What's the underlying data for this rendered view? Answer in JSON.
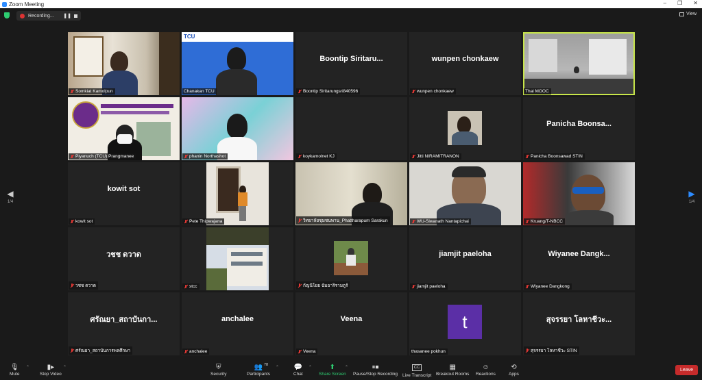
{
  "window": {
    "title": "Zoom Meeting",
    "minimize": "–",
    "maximize": "❐",
    "close": "✕"
  },
  "topbar": {
    "recording_label": "Recording...",
    "pause_glyph": "❚❚",
    "view_label": "View"
  },
  "nav": {
    "page_left": "1/4",
    "page_right": "1/4",
    "left_arrow": "◀",
    "right_arrow": "▶"
  },
  "tiles": [
    {
      "name_label": "Somkiat Kamolpun",
      "center_text": "",
      "active": false
    },
    {
      "name_label": "Chanakan TCU",
      "center_text": "",
      "active": false
    },
    {
      "name_label": "Boontip Siritarungsri840596",
      "center_text": "Boontip  Siritaru...",
      "active": false
    },
    {
      "name_label": "wunpen chonkaew",
      "center_text": "wunpen chonkaew",
      "active": false
    },
    {
      "name_label": "Thai MOOC",
      "center_text": "",
      "active": true
    },
    {
      "name_label": "Piyanuch (TCU) Prangmanee",
      "center_text": "",
      "active": false
    },
    {
      "name_label": "phanin Northashot",
      "center_text": "",
      "active": false
    },
    {
      "name_label": "koykamolnet KJ",
      "center_text": "",
      "active": false
    },
    {
      "name_label": "Jitti NIRAMITRANON",
      "center_text": "",
      "active": false
    },
    {
      "name_label": "Panicha Boonsawad STIN",
      "center_text": "Panicha  Boonsa...",
      "active": false
    },
    {
      "name_label": "kowit sot",
      "center_text": "kowit sot",
      "active": false
    },
    {
      "name_label": "Pete Thipwajana",
      "center_text": "",
      "active": false
    },
    {
      "name_label": "วิทยาลัยชุมชนพาน_Phattharapum Sarakun",
      "center_text": "",
      "active": false
    },
    {
      "name_label": "WU-Siwanath Nantapichai",
      "center_text": "",
      "active": false
    },
    {
      "name_label": "Kruang/T-NBCC",
      "center_text": "",
      "active": false
    },
    {
      "name_label": "วชช ดวาด",
      "center_text": "วชช ดวาด",
      "active": false
    },
    {
      "name_label": "stcc",
      "center_text": "",
      "active": false
    },
    {
      "name_label": "กัญนิโยย ฉัมอาริรามฤูร์",
      "center_text": "",
      "active": false
    },
    {
      "name_label": "jiamjit paeloha",
      "center_text": "jiamjit paeloha",
      "active": false
    },
    {
      "name_label": "Wiyanee Dangkong",
      "center_text": "Wiyanee  Dangk...",
      "active": false
    },
    {
      "name_label": "ศรัณยา_สถาบันการพลศึกษา",
      "center_text": "ศรัณยา_สถาบันกา...",
      "active": false
    },
    {
      "name_label": "anchalee",
      "center_text": "anchalee",
      "active": false
    },
    {
      "name_label": "Veena",
      "center_text": "Veena",
      "active": false
    },
    {
      "name_label": "thasanee pokhun",
      "center_text": "",
      "active": false,
      "avatar_letter": "t",
      "avatar_color": "#5b2fa6"
    },
    {
      "name_label": "สุจรรยา  โลหาชีวะ STIN",
      "center_text": "สุจรรยา  โลหาชีวะ...",
      "active": false
    }
  ],
  "toolbar": {
    "mute": "Mute",
    "stop_video": "Stop Video",
    "security": "Security",
    "participants": "Participants",
    "participants_count": "78",
    "chat": "Chat",
    "share_screen": "Share Screen",
    "pause_stop_recording": "Pause/Stop Recording",
    "live_transcript": "Live Transcript",
    "cc_glyph": "CC",
    "breakout_rooms": "Breakout Rooms",
    "reactions": "Reactions",
    "apps": "Apps",
    "leave": "Leave"
  },
  "colors": {
    "accent_active": "#c8e64a",
    "leave_red": "#c62b2b",
    "share_green": "#2ecc71",
    "recording_red": "#d33"
  }
}
